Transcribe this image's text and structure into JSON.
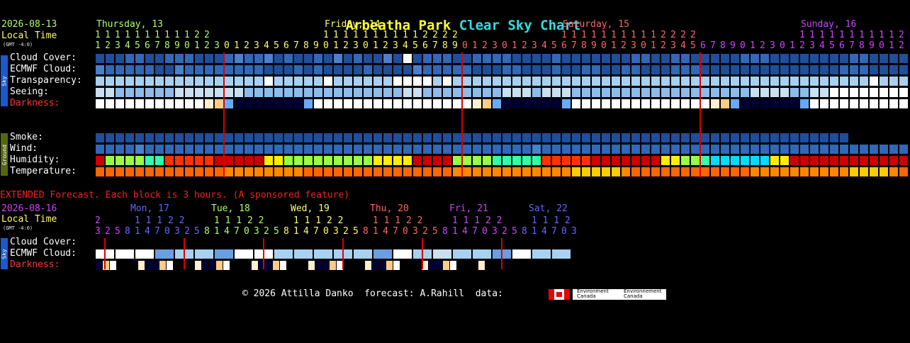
{
  "title": {
    "part1": "Arbeatha Park",
    "part2": "Clear Sky Chart"
  },
  "main": {
    "date": "2026-08-13",
    "local_time": "Local Time",
    "gmt": "(GMT -4:0)",
    "days": [
      {
        "label": "Thursday, 13",
        "color": "#aaff66"
      },
      {
        "label": "Friday, 14",
        "color": "#ffff66"
      },
      {
        "label": "Saturday, 15",
        "color": "#ff6666"
      },
      {
        "label": "Sunday, 16",
        "color": "#cc44ff"
      }
    ],
    "sky_tab": "Sky",
    "ground_tab": "Ground",
    "rows": {
      "cloud": "Cloud Cover:",
      "ecmwf": "ECMWF Cloud:",
      "transparency": "Transparency:",
      "seeing": "Seeing:",
      "darkness": "Darkness:",
      "smoke": "Smoke:",
      "wind": "Wind:",
      "humidity": "Humidity:",
      "temperature": "Temperature:"
    }
  },
  "extended": {
    "note": "EXTENDED Forecast. Each block is 3 hours. (A sponsored feature)",
    "date": "2026-08-16",
    "local_time": "Local Time",
    "gmt": "(GMT -4:0)",
    "days": [
      {
        "label": "Mon, 17",
        "color": "#6666ff"
      },
      {
        "label": "Tue, 18",
        "color": "#aaff66"
      },
      {
        "label": "Wed, 19",
        "color": "#ffff66"
      },
      {
        "label": "Thu, 20",
        "color": "#ff6666"
      },
      {
        "label": "Fri, 21",
        "color": "#cc44ff"
      },
      {
        "label": "Sat, 22",
        "color": "#6666ff"
      }
    ],
    "rows": {
      "cloud": "Cloud Cover:",
      "ecmwf": "ECMWF Cloud:",
      "darkness": "Darkness:"
    }
  },
  "footer": {
    "copyright": "© 2026 Attilla Danko  forecast: A.Rahill  data:",
    "env1": "Environment Canada",
    "env2": "Environnement Canada"
  },
  "chart_data": {
    "type": "heatmap",
    "hours_main": "1234567890123012345678901230123456789012301234567890123012345678901230123456789012301234567890",
    "tens_main": "1 1 1 1 1 1 1 1 1 1 1 2 2 2 2",
    "ext_hours": "3258147032581470325814703258147032581470325814703258147032581470",
    "ext_tens": "1 1 1 2 2",
    "colors": {
      "cloud": [
        "#0a2a6a",
        "#1f4f9a",
        "#3168b8",
        "#4a80cc",
        "#6a9ee0",
        "#8cbcec",
        "#a8d0f0",
        "#c8e0f0",
        "#ffffff"
      ],
      "darkness": [
        "#000033",
        "#001a66",
        "#0a3a99",
        "#1e6ad8",
        "#66aaff",
        "#ffcc88",
        "#ffeed0",
        "#ffffff"
      ],
      "humidity": [
        "#ee6600",
        "#ff3300",
        "#cc0000",
        "#ffee00",
        "#99ff44",
        "#33ffaa",
        "#00ddff"
      ],
      "temperature": [
        "#ff6600",
        "#ff8800",
        "#ffcc00"
      ]
    },
    "rows": {
      "cloud": "1112211222111232231211213121131812221122221111211111112211221111122211111111221111111111111111811111",
      "ecmwf": "3222221132222222211121211112111132222211122111211221122111222111111111111112221111111111888888888888888",
      "transparency": "6666666666666666686666686666668888686666666666666666666666666666666666666666668666666668888888",
      "seeing": "7755555577777775555555555555555775555555577757775555555555555555557777557788888888888888888888",
      "darkness": "7777777777765400000004777777777777777765400000047777777777777765400000047777777777777776540000",
      "smoke": "1111111111111111111111111111111111111111111111111111111111111111111111111111",
      "wind": "2222322222222222222222222222222222222222222232222222222222222222222222222222222222222222221112",
      "humidity": "2444455111112222233444444444333322224444555551111122222223344566666633222222222222223322211111",
      "temperature": "0000000000000111111110000000000000001111111111112222210000000000001111111111222210000000000000"
    },
    "ext_rows": {
      "cloud": "88846648866666486766486648666666",
      "ecmwf": "",
      "darkness": "0578886005788860057888600578886005788860057888600578886"
    }
  }
}
